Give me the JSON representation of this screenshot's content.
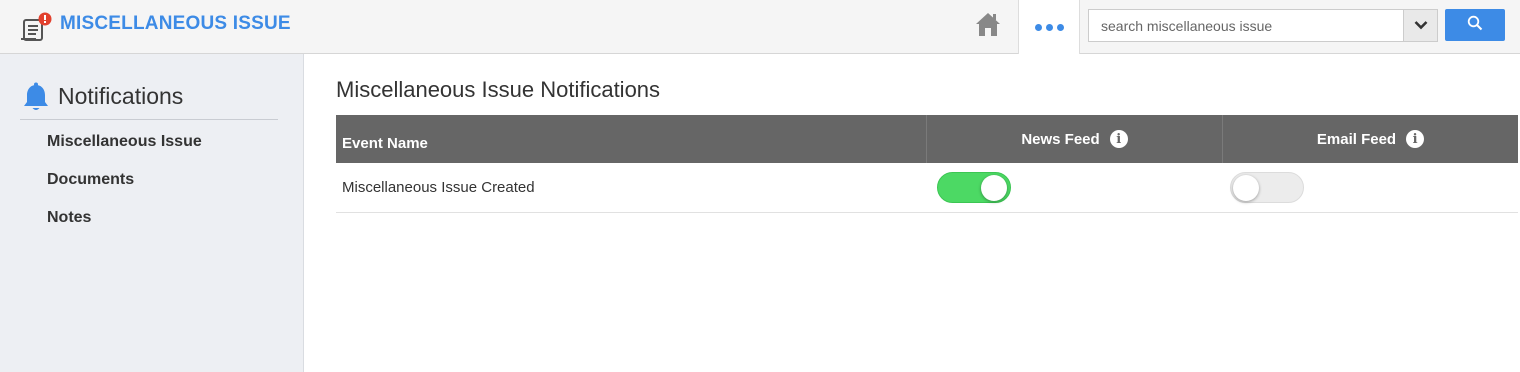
{
  "header": {
    "title": "MISCELLANEOUS ISSUE",
    "app_icon": "document-alert-icon",
    "home_icon": "home-icon",
    "more_icon": "more-dots-icon",
    "search": {
      "placeholder": "search miscellaneous issue",
      "value": ""
    },
    "accent": "#3d8be6"
  },
  "sidebar": {
    "title": "Notifications",
    "icon": "bell-icon",
    "items": [
      {
        "label": "Miscellaneous Issue"
      },
      {
        "label": "Documents"
      },
      {
        "label": "Notes"
      }
    ]
  },
  "main": {
    "title": "Miscellaneous Issue Notifications",
    "columns": {
      "event": "Event Name",
      "news": "News Feed",
      "email": "Email Feed"
    },
    "info_glyph": "i",
    "rows": [
      {
        "event": "Miscellaneous Issue Created",
        "news_feed": true,
        "email_feed": false
      }
    ],
    "toggle_on_color": "#4cd964"
  }
}
